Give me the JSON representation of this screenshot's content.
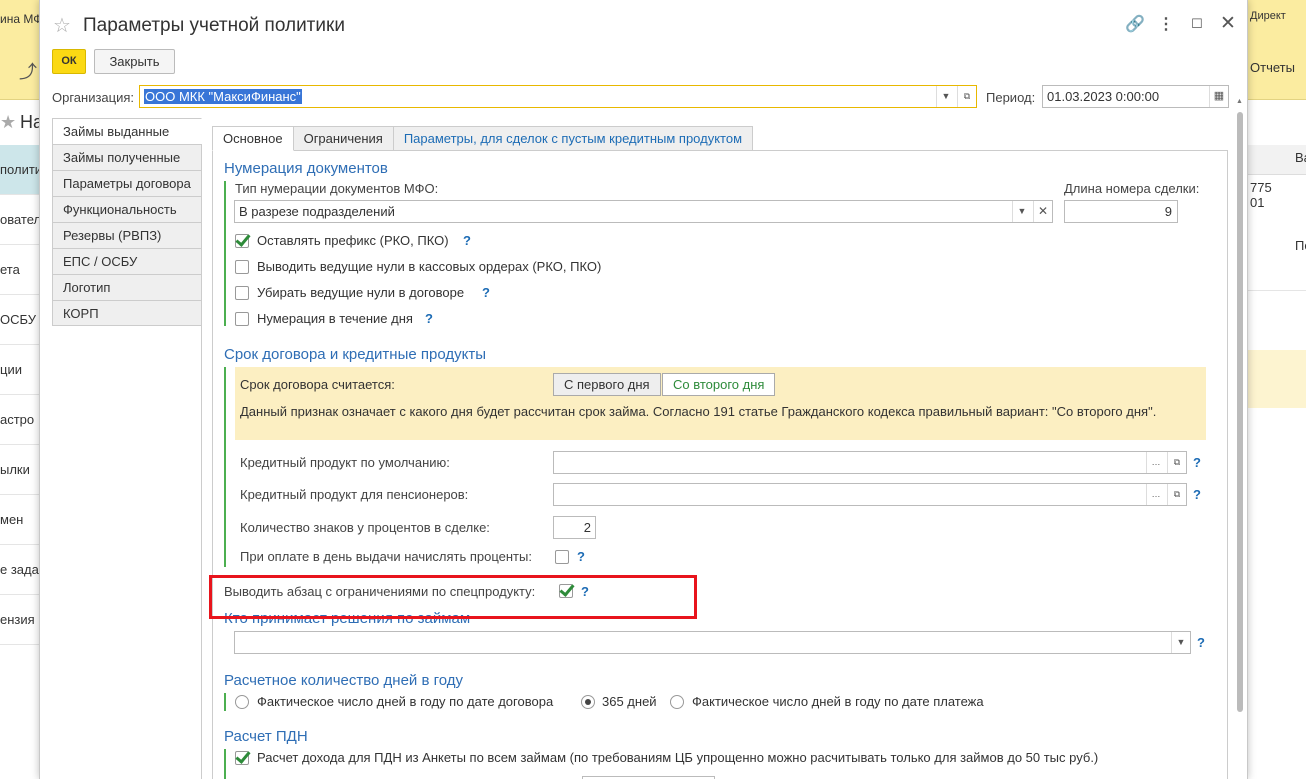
{
  "background": {
    "topbar_left": "ина МФО",
    "topbar_right": "Директ",
    "reports": "Отчеты",
    "left_header": "На",
    "left_items": [
      "полити",
      "ователи",
      "ета",
      "ОСБУ",
      "ции",
      "астро",
      "ылки",
      "мен",
      "е зада",
      "ензия"
    ],
    "right_col_header": "Ва",
    "right_values": [
      "775",
      "01"
    ],
    "right_po": "По"
  },
  "window": {
    "title": "Параметры учетной политики",
    "ok": "ОК",
    "close": "Закрыть",
    "org_label": "Организация:",
    "org_value": "ООО МКК \"МаксиФинанс\"",
    "period_label": "Период:",
    "period_value": "01.03.2023  0:00:00"
  },
  "left_tabs": [
    "Займы выданные",
    "Займы полученные",
    "Параметры договора",
    "Функциональность",
    "Резервы (РВПЗ)",
    "ЕПС / ОСБУ",
    "Логотип",
    "КОРП"
  ],
  "top_tabs": [
    "Основное",
    "Ограничения",
    "Параметры, для сделок с пустым кредитным продуктом"
  ],
  "numbering": {
    "title": "Нумерация документов",
    "type_label": "Тип нумерации документов МФО:",
    "type_value": "В разрезе подразделений",
    "length_label": "Длина номера сделки:",
    "length_value": "9",
    "opt1": "Оставлять префикс (РКО, ПКО)",
    "opt2": "Выводить ведущие нули в кассовых ордерах (РКО, ПКО)",
    "opt3": "Убирать ведущие нули в договоре",
    "opt4": "Нумерация в течение дня",
    "help": "?"
  },
  "term": {
    "title": "Срок договора и кредитные продукты",
    "term_label": "Срок договора считается:",
    "seg1": "С первого дня",
    "seg2": "Со второго дня",
    "note": "Данный признак означает с какого дня будет рассчитан срок займа. Согласно 191 статье Гражданского кодекса правильный вариант: \"Со второго дня\".",
    "credit_default": "Кредитный продукт по умолчанию:",
    "credit_pension": "Кредитный продукт для пенсионеров:",
    "digits_label": "Количество знаков у процентов в сделке:",
    "digits_value": "2",
    "accrue_label": "При оплате в день выдачи начислять проценты:",
    "restrict_label": "Выводить абзац с ограничениями по спецпродукту:"
  },
  "decision": {
    "title": "Кто принимает решения по займам"
  },
  "days": {
    "title": "Расчетное количество дней в году",
    "r1": "Фактическое число дней в году по дате договора",
    "r2": "365 дней",
    "r3": "Фактическое число дней в году по дате платежа"
  },
  "pdn": {
    "title": "Расчет ПДН",
    "opt1": "Расчет дохода для ПДН из Анкеты по всем займам (по требованиям ЦБ упрощенно можно расчитывать только для займов до 50 тыс руб.)"
  }
}
